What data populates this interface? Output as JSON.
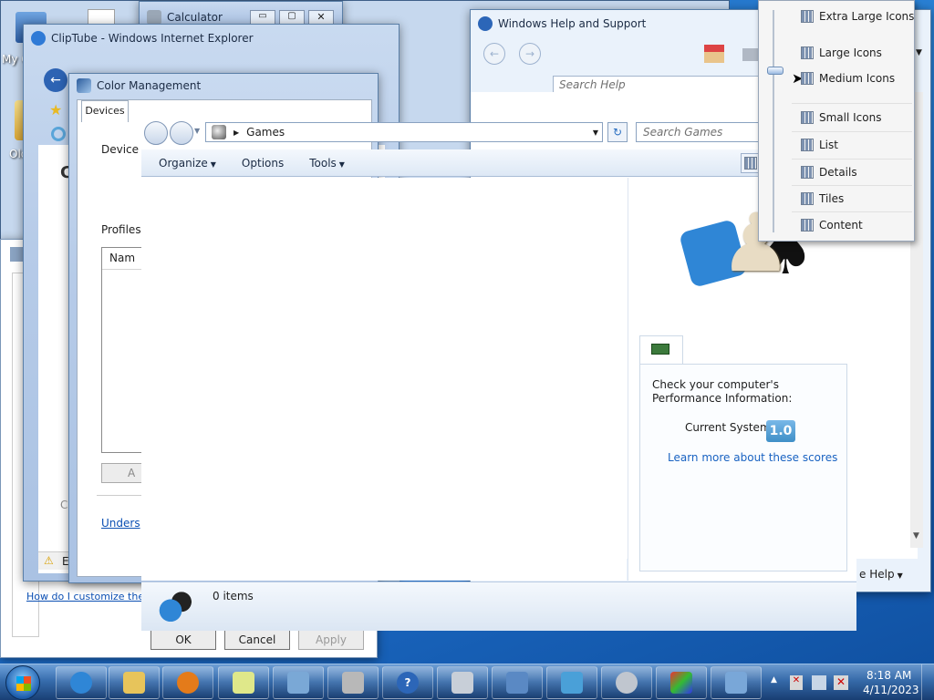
{
  "desktop": {
    "icons": [
      "My C",
      "Old"
    ]
  },
  "windows": {
    "calculator": {
      "title": "Calculator"
    },
    "cliptube": {
      "title": "ClipTube - Windows Internet Explorer"
    },
    "color_mgmt": {
      "title": "Color Management",
      "tab": "Devices",
      "device_label": "Device",
      "profiles_label": "Profiles",
      "name_col": "Nam",
      "link": "Unders",
      "add_btn": "A",
      "cols_letter": "C",
      "ok": "OK",
      "cancel": "Cancel",
      "apply": "Apply"
    },
    "customize_link": "How do I customize the t",
    "side_letter": "E",
    "help": {
      "title": "Windows Help and Support",
      "search_placeholder": "Search Help",
      "footer_help": "e Help"
    }
  },
  "explorer": {
    "breadcrumb": "Games",
    "search_placeholder": "Search Games",
    "toolbar": {
      "organize": "Organize",
      "options": "Options",
      "tools": "Tools"
    },
    "preview": {
      "perf_text": "Check your computer's Performance Information:",
      "current_system": "Current System",
      "score": "1.0",
      "learn_link": "Learn more about these scores"
    },
    "status": {
      "items": "0 items"
    }
  },
  "view_menu": {
    "items": [
      "Extra Large Icons",
      "Large Icons",
      "Medium Icons",
      "Small Icons",
      "List",
      "Details",
      "Tiles",
      "Content"
    ],
    "selected": "Medium Icons"
  },
  "taskbar": {
    "time": "8:18 AM",
    "date": "4/11/2023"
  },
  "colors": {
    "accent": "#0b4fb3",
    "desktop": "#1d6cc7",
    "score_badge": "#3f8fc7"
  }
}
